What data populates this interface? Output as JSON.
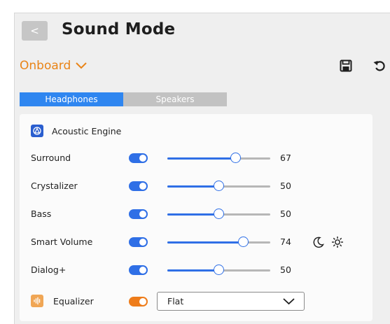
{
  "header": {
    "back_label": "<",
    "title": "Sound Mode"
  },
  "profile": {
    "selected": "Onboard"
  },
  "tabs": [
    {
      "label": "Headphones",
      "active": true
    },
    {
      "label": "Speakers",
      "active": false
    }
  ],
  "acoustic_engine": {
    "label": "Acoustic Engine"
  },
  "controls": [
    {
      "label": "Surround",
      "enabled": true,
      "value": 67,
      "value_text": "67"
    },
    {
      "label": "Crystalizer",
      "enabled": true,
      "value": 50,
      "value_text": "50"
    },
    {
      "label": "Bass",
      "enabled": true,
      "value": 50,
      "value_text": "50"
    },
    {
      "label": "Smart Volume",
      "enabled": true,
      "value": 74,
      "value_text": "74",
      "modes": [
        "moon-icon",
        "sun-icon"
      ]
    },
    {
      "label": "Dialog+",
      "enabled": true,
      "value": 50,
      "value_text": "50"
    }
  ],
  "equalizer": {
    "label": "Equalizer",
    "enabled": true,
    "preset": "Flat"
  },
  "colors": {
    "accent_blue": "#2f6fe6",
    "accent_orange": "#ee7c1a",
    "tab_active": "#2f86f0",
    "engine_icon": "#2a5ecf"
  }
}
